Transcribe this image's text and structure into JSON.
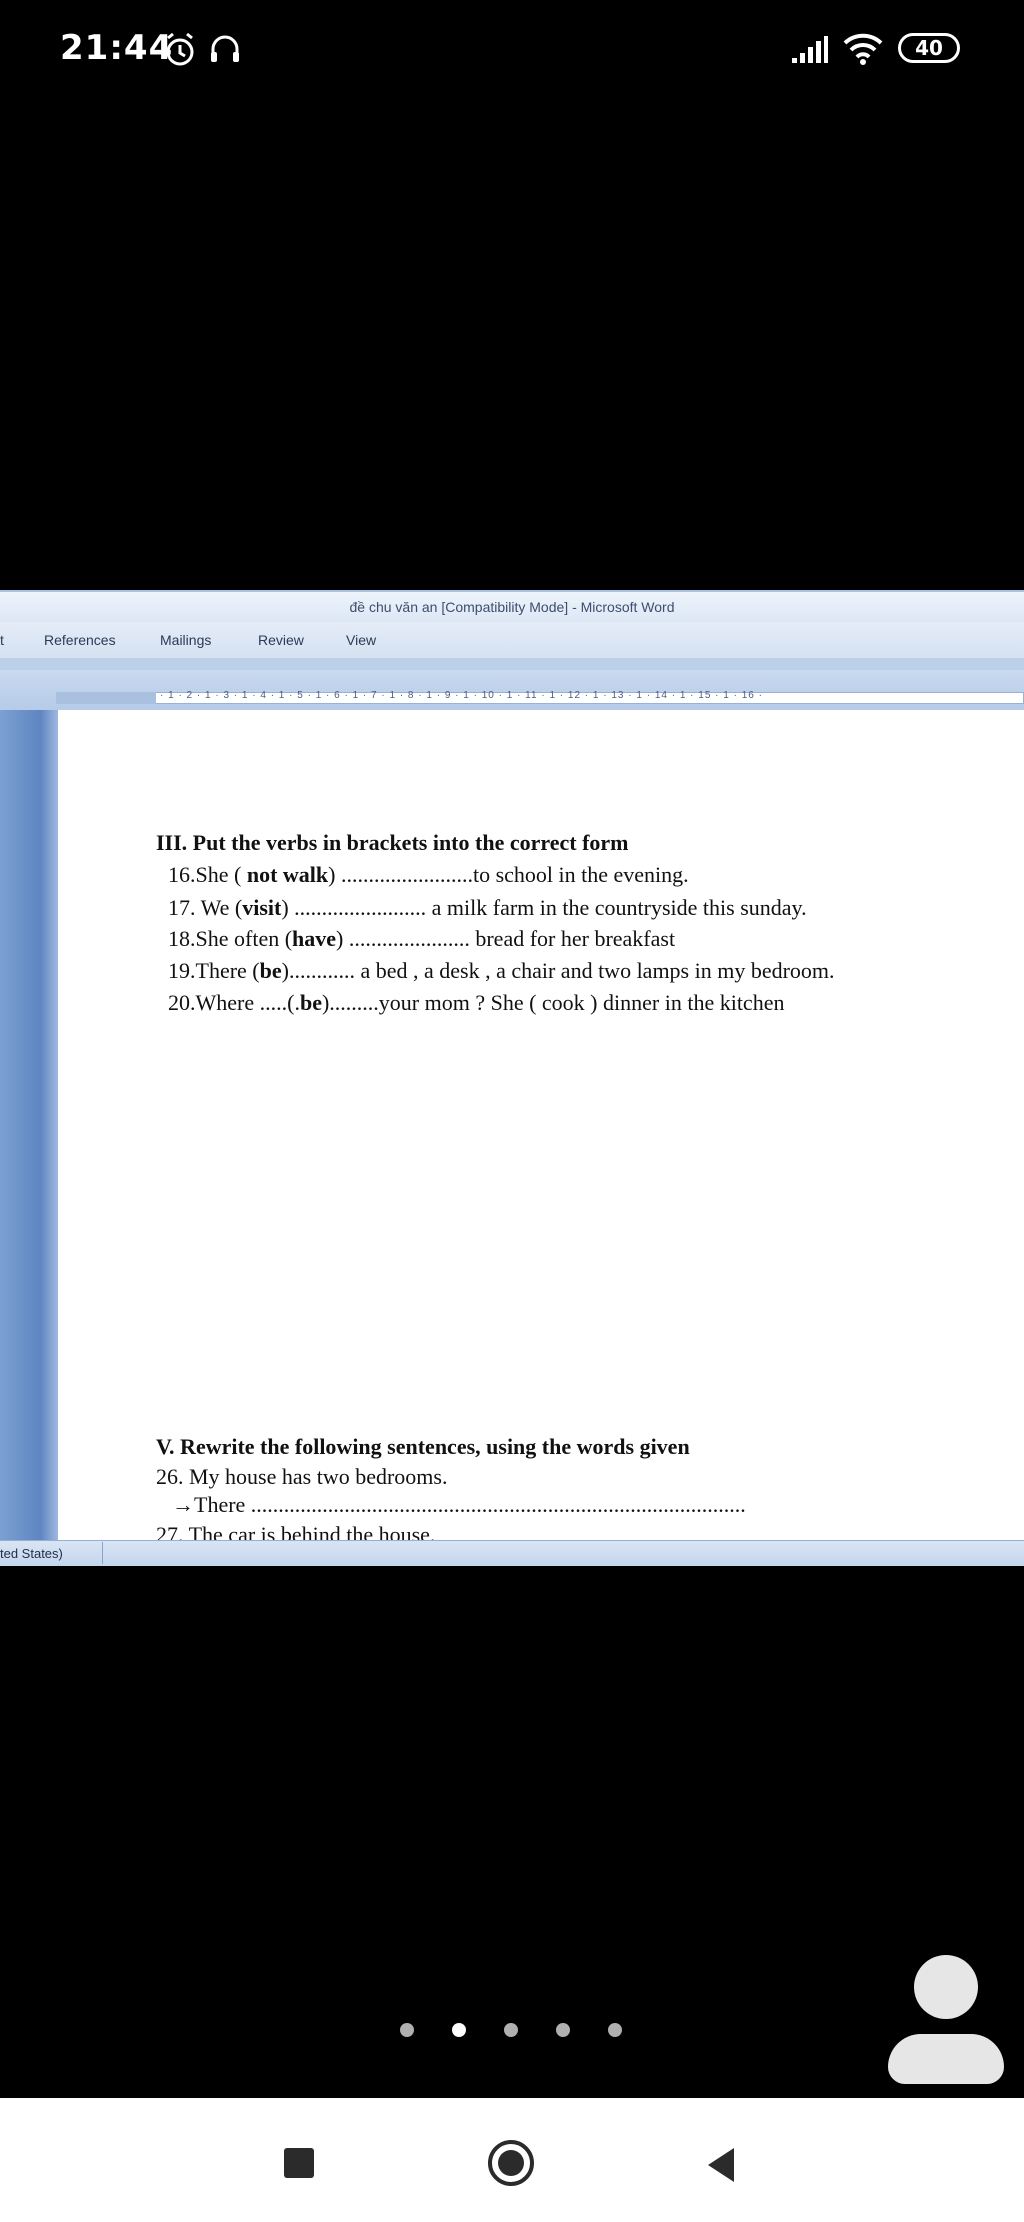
{
  "status_bar": {
    "time": "21:44",
    "battery": "40",
    "icons": [
      "alarm-icon",
      "headphones-icon",
      "signal-icon",
      "wifi-icon",
      "battery-icon"
    ]
  },
  "word_window": {
    "title": "đề chu văn an [Compatibility Mode] - Microsoft Word",
    "tabs": [
      "t",
      "References",
      "Mailings",
      "Review",
      "View"
    ],
    "ruler": "· 1 · 2 · 1 · 3 · 1 · 4 · 1 · 5 · 1 · 6 · 1 · 7 · 1 · 8 · 1 · 9 · 1 · 10 · 1 · 11 · 1 · 12 · 1 · 13 · 1 · 14 · 1 · 15 · 1 · 16 ·",
    "status_language": "ted States)"
  },
  "document": {
    "section3_heading": "III.  Put the verbs in brackets into the correct form",
    "q16": {
      "pre": "16.She ( ",
      "verb": "not walk",
      "post": ") ........................to school in the evening."
    },
    "q17": {
      "pre": "17. We (",
      "verb": "visit",
      "post": ")  ........................ a milk farm in the countryside this sunday."
    },
    "q18": {
      "pre": "18.She  often (",
      "verb": "have",
      "post": ") ...................... bread for her breakfast"
    },
    "q19": {
      "pre": "19.There (",
      "verb": "be",
      "post": ")............ a bed , a desk , a chair and two lamps in my bedroom."
    },
    "q20": {
      "pre": "20.Where .....(.",
      "verb": "be",
      "post": ").........your mom  ?  She ( cook ) dinner in the kitchen"
    },
    "section5_heading": "V.  Rewrite the following sentences, using the words  given",
    "q26": "26. My house has  two bedrooms.",
    "q26_answer": "→There ..........................................................................................",
    "q27": "27.  The car is behind  the house."
  },
  "pager": {
    "count": 5,
    "active_index": 1
  },
  "nav": {
    "buttons": [
      "recent-apps",
      "home",
      "back"
    ]
  }
}
